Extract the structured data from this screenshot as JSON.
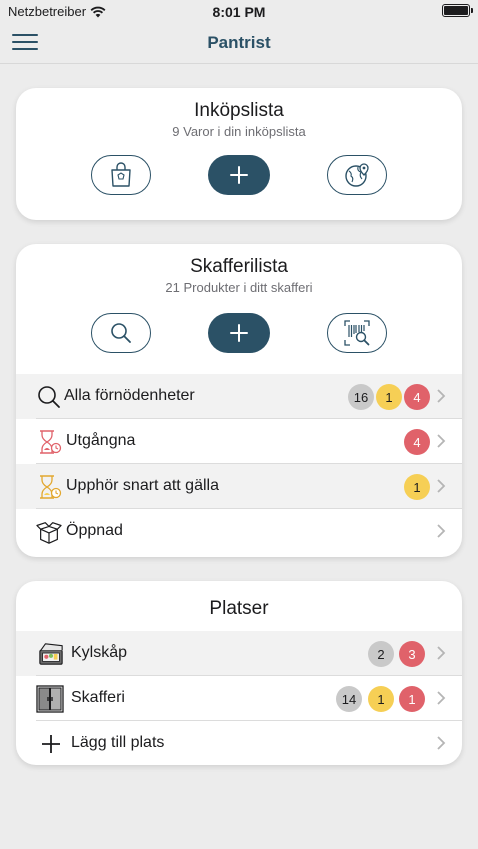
{
  "status": {
    "carrier": "Netzbetreiber",
    "time": "8:01 PM"
  },
  "nav": {
    "title": "Pantrist"
  },
  "shopping": {
    "title": "Inköpslista",
    "subtitle": "9 Varor i din inköpslista"
  },
  "pantry": {
    "title": "Skafferilista",
    "subtitle": "21 Produkter i ditt skafferi",
    "rows": [
      {
        "label": "Alla förnödenheter",
        "badges": {
          "grey": "16",
          "yellow": "1",
          "red": "4"
        }
      },
      {
        "label": "Utgångna",
        "badges": {
          "red": "4"
        }
      },
      {
        "label": "Upphör snart att gälla",
        "badges": {
          "yellow": "1"
        }
      },
      {
        "label": "Öppnad"
      }
    ]
  },
  "places": {
    "title": "Platser",
    "rows": [
      {
        "label": "Kylskåp",
        "badges": {
          "grey": "2",
          "red": "3"
        }
      },
      {
        "label": "Skafferi",
        "badges": {
          "grey": "14",
          "yellow": "1",
          "red": "1"
        }
      },
      {
        "label": "Lägg till plats"
      }
    ]
  },
  "colors": {
    "primary": "#2b5166",
    "grey_badge": "#c9c9c9",
    "yellow_badge": "#f6cf55",
    "red_badge": "#e0626a"
  }
}
